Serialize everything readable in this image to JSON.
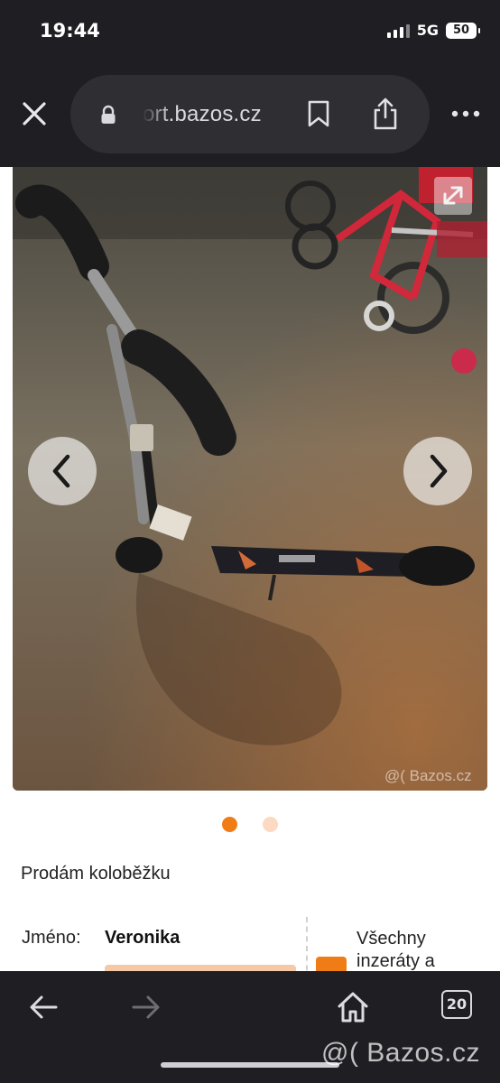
{
  "status": {
    "time": "19:44",
    "network": "5G",
    "battery": "50"
  },
  "browser": {
    "url": "ort.bazos.cz",
    "tabs_count": "20"
  },
  "listing": {
    "title": "Prodám koloběžku",
    "name_label": "Jméno:",
    "name_value": "Veronika",
    "all_ads_label": "Všechny inzeráty a",
    "photo_watermark": "@( Bazos.cz",
    "gallery": {
      "current": 1,
      "total": 2
    }
  },
  "overlay_watermark": "@( Bazos.cz",
  "icons": [
    "close-icon",
    "lock-icon",
    "bookmark-icon",
    "share-icon",
    "more-icon",
    "chevron-left-icon",
    "chevron-right-icon",
    "expand-icon",
    "back-arrow-icon",
    "forward-arrow-icon",
    "home-icon",
    "tabs-icon"
  ],
  "colors": {
    "accent": "#f07c16",
    "chrome": "#1f1f23",
    "url_bar": "#2e2e33"
  }
}
